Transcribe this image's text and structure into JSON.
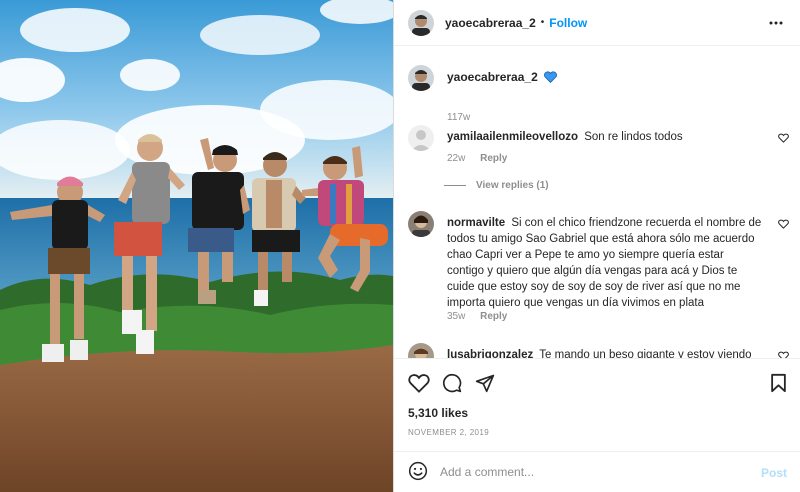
{
  "header": {
    "username": "yaoecabreraa_2",
    "separator": "•",
    "follow_label": "Follow",
    "more_icon": "more-horizontal-icon"
  },
  "caption": {
    "username": "yaoecabreraa_2",
    "emoji": "blue-heart",
    "time": "117w"
  },
  "comments": [
    {
      "username": "yamilaailenmileovellozo",
      "text": "Son re lindos todos",
      "time": "22w",
      "reply_label": "Reply",
      "view_replies": "View replies (1)"
    },
    {
      "username": "normavilte",
      "text": "Si con el chico friendzone recuerda el nombre de todos tu amigo Sao Gabriel que está ahora sólo me acuerdo chao Capri ver a Pepe te amo yo siempre quería estar contigo y quiero que algún día vengas para acá y Dios te cuide que estoy soy de soy de soy de river así que no me importa quiero que vengas un día vivimos en plata",
      "time": "35w",
      "reply_label": "Reply"
    },
    {
      "username": "lusabrigonzalez",
      "text": "Te mando un beso gigante y estoy viendo"
    }
  ],
  "actions": {
    "like_icon": "heart-icon",
    "comment_icon": "comment-icon",
    "share_icon": "paper-plane-icon",
    "save_icon": "bookmark-icon"
  },
  "likes": "5,310 likes",
  "date": "NOVEMBER 2, 2019",
  "add_comment": {
    "placeholder": "Add a comment...",
    "post_label": "Post",
    "emoji_icon": "smiley-icon"
  },
  "colors": {
    "accent": "#0095f6",
    "post_disabled": "#b2dffc",
    "muted": "#8e8e8e",
    "verified_heart": "#3897f0"
  }
}
